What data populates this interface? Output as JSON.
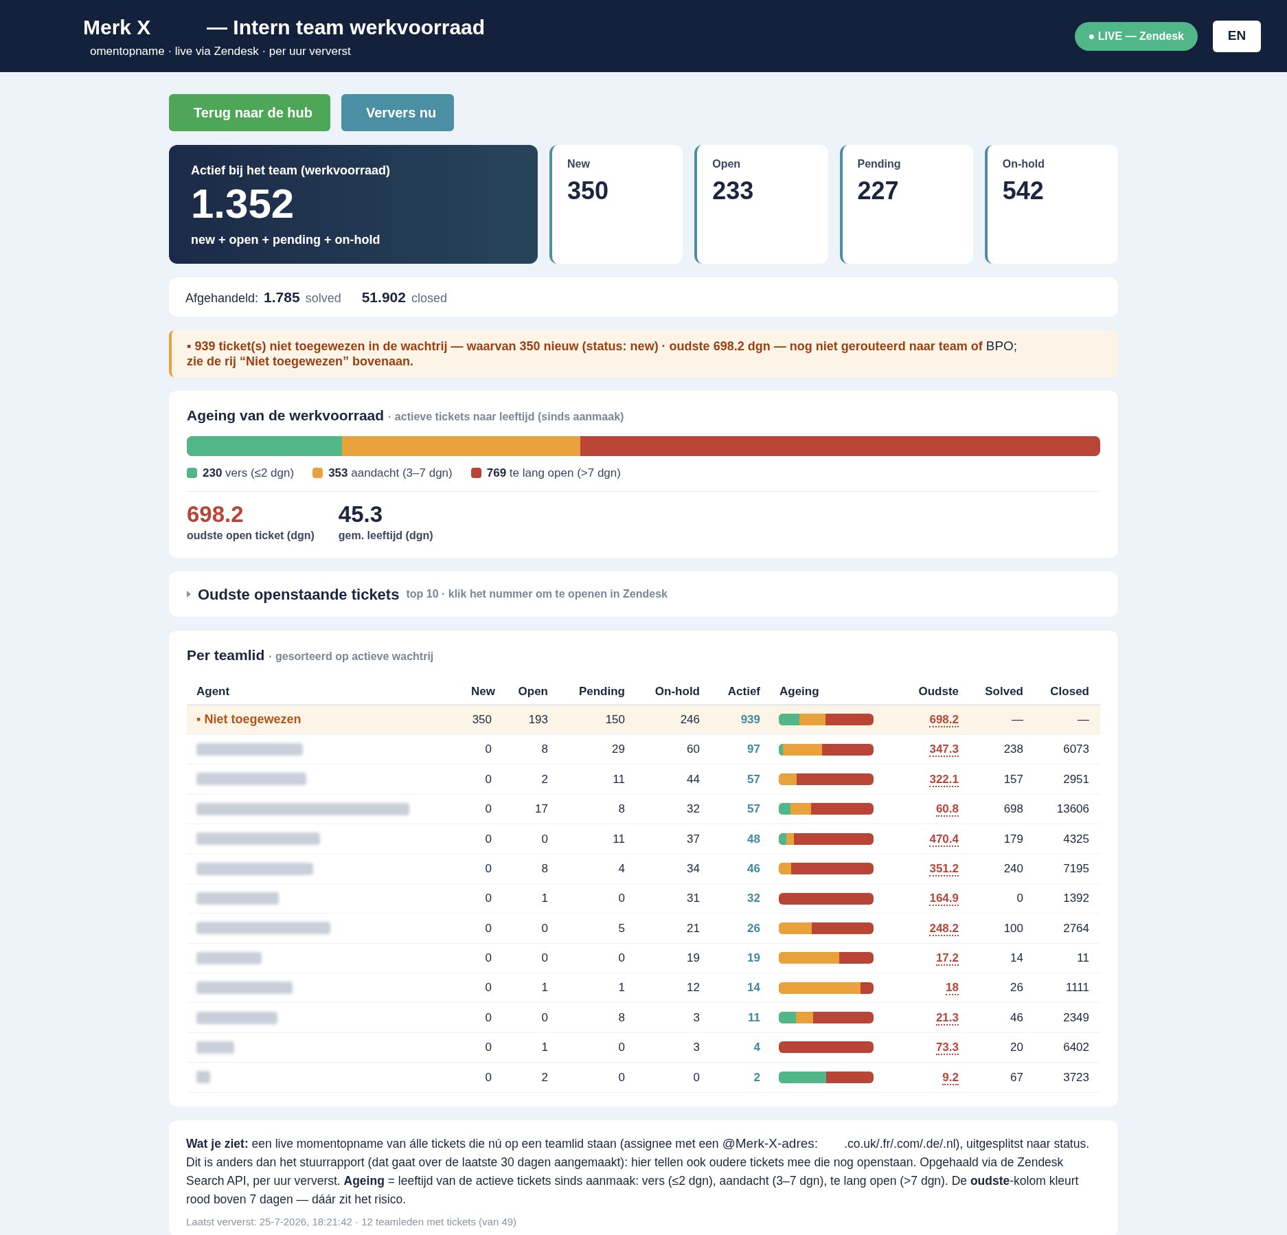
{
  "header": {
    "brand": "Merk X",
    "title": "— Intern team werkvoorraad",
    "subtitle": "omentopname · live via Zendesk · per uur ververst",
    "live_badge": "● LIVE — Zendesk",
    "language_button": "EN"
  },
  "actions": [
    {
      "label": "Terug naar de hub",
      "kind": "back"
    },
    {
      "label": "Ververs nu",
      "kind": "refresh"
    }
  ],
  "summary": {
    "label": "Actief bij het team (werkvoorraad)",
    "value": "1.352",
    "caption": "new + open + pending + on-hold"
  },
  "status_cards": [
    {
      "label": "New",
      "value": "350"
    },
    {
      "label": "Open",
      "value": "233"
    },
    {
      "label": "Pending",
      "value": "227"
    },
    {
      "label": "On-hold",
      "value": "542"
    }
  ],
  "handled": {
    "label": "Afgehandeld:",
    "solved_value": "1.785",
    "solved_label": "solved",
    "closed_value": "51.902",
    "closed_label": "closed"
  },
  "alert": {
    "text": "▪ **939** ticket(s) niet toegewezen in de wachtrij — waarvan **350** nieuw (status: new) · oudste **698.2** dgn — nog niet gerouteerd naar team of",
    "tail": "BPO;",
    "text2": "zie de rij “Niet toegewezen” bovenaan."
  },
  "ageing": {
    "title": "Ageing van de werkvoorraad",
    "subtitle": "· actieve tickets naar leeftijd (sinds aanmaak)",
    "bar": [
      {
        "kind": "attention",
        "level": 0.431
      },
      {
        "kind": "fresh",
        "level": 0.17
      }
    ],
    "segments": [
      {
        "color": "#52b788",
        "count": "230",
        "label": "vers (≤2 dgn)"
      },
      {
        "color": "#e9a23b",
        "count": "353",
        "label": "aandacht (3–7 dgn)"
      },
      {
        "color": "#b94536",
        "count": "769",
        "label": "te lang open (>7 dgn)"
      }
    ],
    "stats": [
      {
        "value": "698.2",
        "label": "oudste open ticket (dgn)",
        "kind": "alert"
      },
      {
        "value": "45.3",
        "label": "gem. leeftijd (dgn)",
        "kind": "normal"
      }
    ]
  },
  "oldest": {
    "title": "Oudste openstaande tickets",
    "subtitle": "top 10 · klik het nummer om te openen in Zendesk"
  },
  "team": {
    "title": "Per teamlid",
    "subtitle": "· gesorteerd op actieve wachtrij",
    "columns": [
      "Agent",
      "New",
      "Open",
      "Pending",
      "On-hold",
      "Actief",
      "Ageing",
      "Oudste",
      "Solved",
      "Closed"
    ],
    "rows": [
      {
        "kind": "unassigned",
        "agent": "▪ Niet toegewezen",
        "new": "350",
        "open": "193",
        "pending": "150",
        "onhold": "246",
        "actief": "939",
        "ageing": [
          {
            "kind": "attention",
            "level": 0.49
          },
          {
            "kind": "fresh",
            "level": 0.22
          }
        ],
        "oudste": "698.2",
        "solved": "—",
        "closed": "—"
      },
      {
        "kind": "redacted",
        "new": "0",
        "open": "8",
        "pending": "29",
        "onhold": "60",
        "actief": "97",
        "ageing": [
          {
            "kind": "attention",
            "level": 0.46
          },
          {
            "kind": "fresh",
            "level": 0.04
          }
        ],
        "oudste": "347.3",
        "solved": "238",
        "closed": "6073"
      },
      {
        "kind": "redacted",
        "new": "0",
        "open": "2",
        "pending": "11",
        "onhold": "44",
        "actief": "57",
        "ageing": [
          {
            "kind": "attention",
            "level": 0.19
          }
        ],
        "oudste": "322.1",
        "solved": "157",
        "closed": "2951"
      },
      {
        "kind": "redacted",
        "new": "0",
        "open": "17",
        "pending": "8",
        "onhold": "32",
        "actief": "57",
        "ageing": [
          {
            "kind": "attention",
            "level": 0.34
          },
          {
            "kind": "fresh",
            "level": 0.12
          }
        ],
        "oudste": "60.8",
        "solved": "698",
        "closed": "13606"
      },
      {
        "kind": "redacted",
        "new": "0",
        "open": "0",
        "pending": "11",
        "onhold": "37",
        "actief": "48",
        "ageing": [
          {
            "kind": "attention",
            "level": 0.16
          },
          {
            "kind": "fresh",
            "level": 0.08
          }
        ],
        "oudste": "470.4",
        "solved": "179",
        "closed": "4325"
      },
      {
        "kind": "redacted",
        "new": "0",
        "open": "8",
        "pending": "4",
        "onhold": "34",
        "actief": "46",
        "ageing": [
          {
            "kind": "attention",
            "level": 0.13
          }
        ],
        "oudste": "351.2",
        "solved": "240",
        "closed": "7195"
      },
      {
        "kind": "redacted",
        "new": "0",
        "open": "1",
        "pending": "0",
        "onhold": "31",
        "actief": "32",
        "ageing": [],
        "oudste": "164.9",
        "solved": "0",
        "closed": "1392"
      },
      {
        "kind": "redacted",
        "new": "0",
        "open": "0",
        "pending": "5",
        "onhold": "21",
        "actief": "26",
        "ageing": [
          {
            "kind": "attention",
            "level": 0.35
          }
        ],
        "oudste": "248.2",
        "solved": "100",
        "closed": "2764"
      },
      {
        "kind": "redacted",
        "new": "0",
        "open": "0",
        "pending": "0",
        "onhold": "19",
        "actief": "19",
        "ageing": [
          {
            "kind": "attention",
            "level": 0.64
          }
        ],
        "oudste": "17.2",
        "solved": "14",
        "closed": "11"
      },
      {
        "kind": "redacted",
        "new": "0",
        "open": "1",
        "pending": "1",
        "onhold": "12",
        "actief": "14",
        "ageing": [
          {
            "kind": "attention",
            "level": 0.86
          }
        ],
        "oudste": "18",
        "solved": "26",
        "closed": "1111"
      },
      {
        "kind": "redacted",
        "new": "0",
        "open": "0",
        "pending": "8",
        "onhold": "3",
        "actief": "11",
        "ageing": [
          {
            "kind": "attention",
            "level": 0.36
          },
          {
            "kind": "fresh",
            "level": 0.18
          }
        ],
        "oudste": "21.3",
        "solved": "46",
        "closed": "2349"
      },
      {
        "kind": "redacted",
        "new": "0",
        "open": "1",
        "pending": "0",
        "onhold": "3",
        "actief": "4",
        "ageing": [],
        "oudste": "73.3",
        "solved": "20",
        "closed": "6402"
      },
      {
        "kind": "redacted",
        "new": "0",
        "open": "2",
        "pending": "0",
        "onhold": "0",
        "actief": "2",
        "ageing": [
          {
            "kind": "fresh",
            "level": 0.5
          }
        ],
        "oudste": "9.2",
        "solved": "67",
        "closed": "3723"
      }
    ]
  },
  "explanation": {
    "parts": [
      {
        "kind": "plain",
        "text": "**Wat je ziet:** een live momentopname van álle tickets die nú op een teamlid staan (assignee met een "
      },
      {
        "kind": "alt_font",
        "text": "@Merk-X-adres:"
      },
      {
        "kind": "gap",
        "text": ".co.uk/.fr/.com/.de/.nl), uitgesplitst naar status. Dit is anders dan het stuurrapport (dat gaat over de laatste 30 dagen aangemaakt): hier tellen ook oudere tickets mee die nog openstaan. Opgehaald via de Zendesk Search API, per uur ververst. **Ageing** = leeftijd van de actieve tickets sinds aanmaak: vers (≤2 dgn), aandacht (3–7 dgn), te lang open (>7 dgn). De **oudste**-kolom kleurt rood boven 7 dagen — dáár zit het risico."
      }
    ],
    "footnote": "Laatst ververst: 25-7-2026, 18:21:42 · 12 teamleden met tickets (van 49)"
  }
}
